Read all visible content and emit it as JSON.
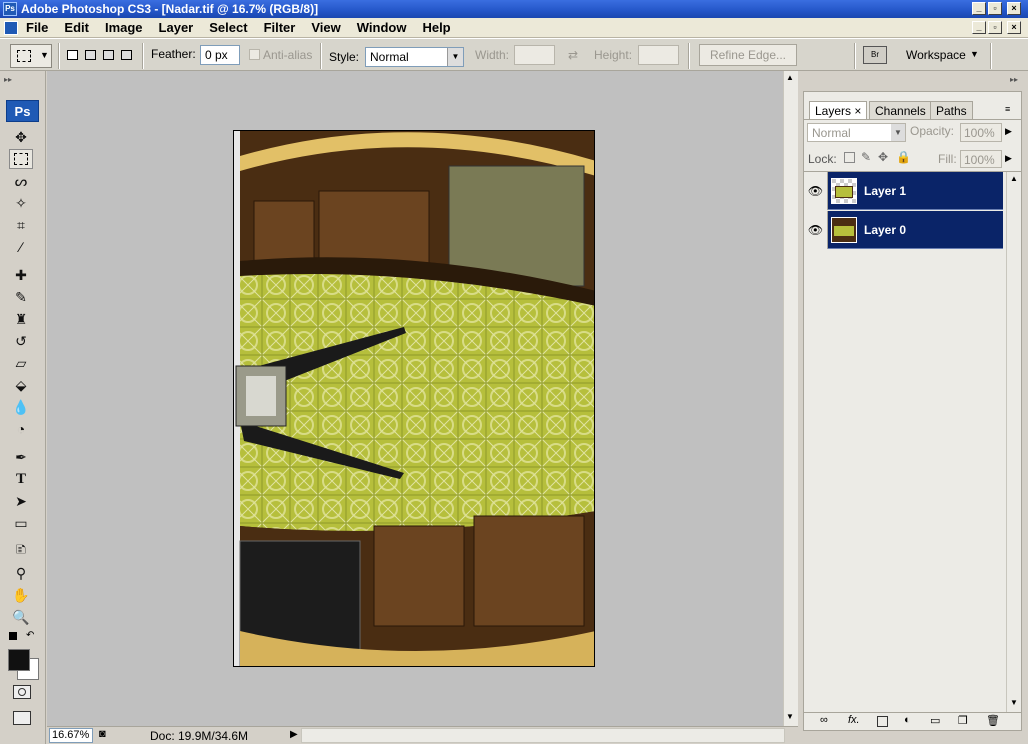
{
  "window": {
    "title": "Adobe Photoshop CS3 - [Nadar.tif @ 16.7% (RGB/8)]",
    "app_icon": "Ps",
    "controls": [
      "_",
      "▫",
      "×"
    ]
  },
  "menu": [
    "File",
    "Edit",
    "Image",
    "Layer",
    "Select",
    "Filter",
    "View",
    "Window",
    "Help"
  ],
  "options": {
    "feather_label": "Feather:",
    "feather_value": "0 px",
    "antialias_label": "Anti-alias",
    "style_label": "Style:",
    "style_value": "Normal",
    "width_label": "Width:",
    "height_label": "Height:",
    "refine_edge": "Refine Edge...",
    "workspace": "Workspace"
  },
  "toolbox": {
    "badge": "Ps",
    "tools": [
      "move-tool",
      "marquee-tool",
      "lasso-tool",
      "magic-wand-tool",
      "crop-tool",
      "slice-tool",
      "healing-brush-tool",
      "brush-tool",
      "clone-stamp-tool",
      "history-brush-tool",
      "eraser-tool",
      "paint-bucket-tool",
      "blur-tool",
      "dodge-tool",
      "pen-tool",
      "type-tool",
      "path-selection-tool",
      "rectangle-tool",
      "notes-tool",
      "eyedropper-tool",
      "hand-tool",
      "zoom-tool"
    ],
    "foreground_color": "#000000",
    "background_color": "#ffffff"
  },
  "status": {
    "zoom": "16.67%",
    "doc": "Doc: 19.9M/34.6M"
  },
  "layers_panel": {
    "tabs": [
      "Layers",
      "Channels",
      "Paths"
    ],
    "blend_mode": "Normal",
    "opacity_label": "Opacity:",
    "opacity_value": "100%",
    "lock_label": "Lock:",
    "fill_label": "Fill:",
    "fill_value": "100%",
    "layers": [
      {
        "name": "Layer 1",
        "visible": true,
        "selected": true
      },
      {
        "name": "Layer 0",
        "visible": true,
        "selected": true
      }
    ]
  },
  "colors": {
    "selection": "#0a2468",
    "canvas_bg": "#c0c0c0",
    "floor_green": "#b5bd3a"
  }
}
